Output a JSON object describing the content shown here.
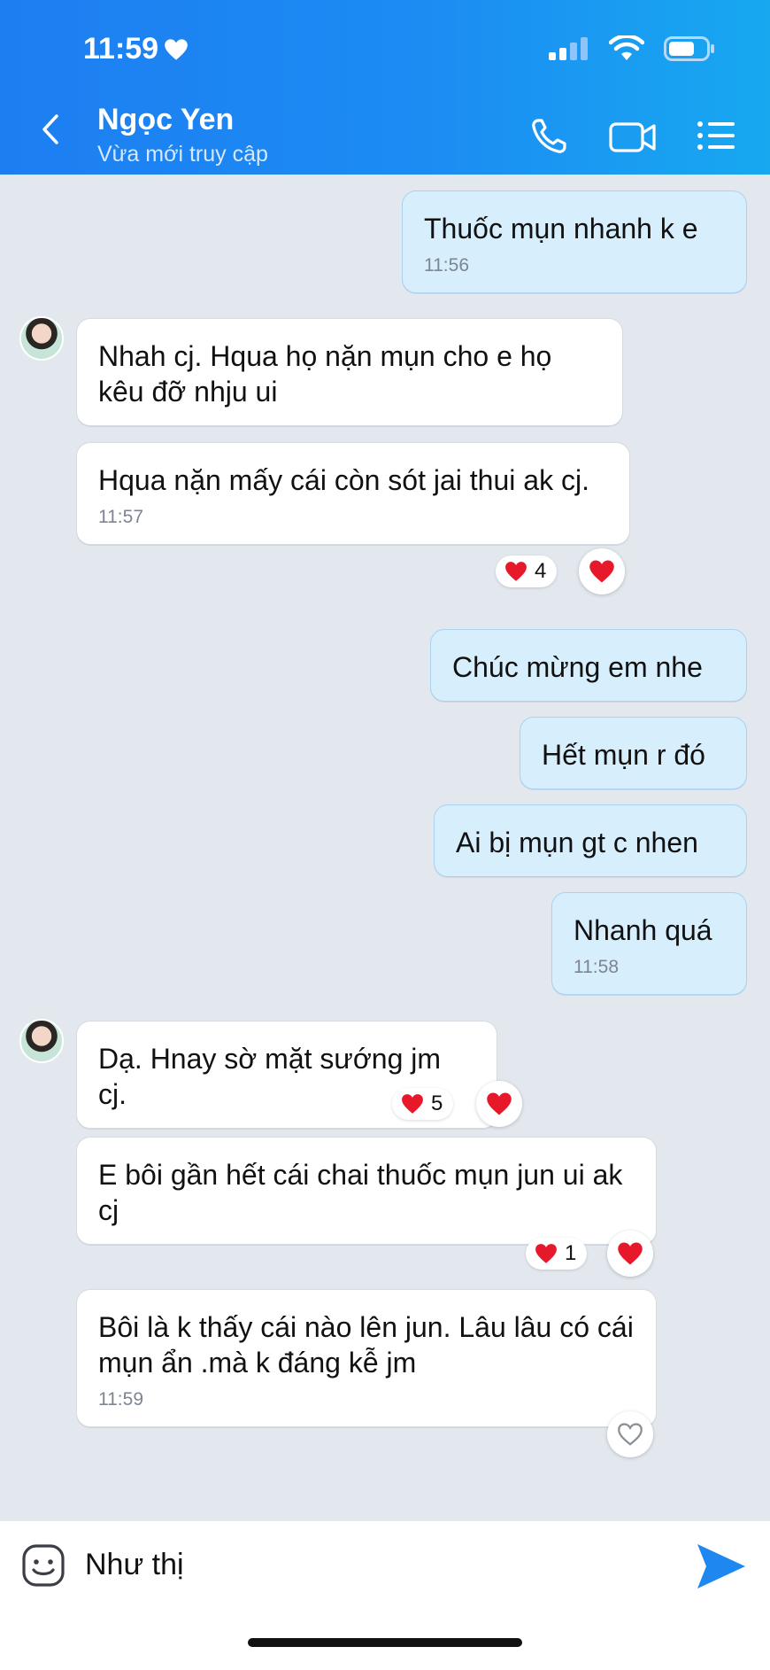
{
  "status_bar": {
    "time": "11:59"
  },
  "header": {
    "contact_name": "Ngọc Yen",
    "status": "Vừa mới truy cập"
  },
  "messages": [
    {
      "dir": "out",
      "text": "Thuốc mụn nhanh k e",
      "time": "11:56"
    },
    {
      "dir": "in",
      "text": "Nhah cj. Hqua họ nặn mụn cho e họ kêu đỡ nhju ui"
    },
    {
      "dir": "in",
      "text": "Hqua nặn mấy cái còn sót jai thui ak cj.",
      "time": "11:57",
      "reaction_count": "4"
    },
    {
      "dir": "out",
      "text": "Chúc mừng em nhe"
    },
    {
      "dir": "out",
      "text": "Hết mụn r đó"
    },
    {
      "dir": "out",
      "text": "Ai bị mụn gt c nhen"
    },
    {
      "dir": "out",
      "text": "Nhanh quá",
      "time": "11:58"
    },
    {
      "dir": "in",
      "text": "Dạ. Hnay sờ mặt sướng jm cj.",
      "reaction_count": "5"
    },
    {
      "dir": "in",
      "text": "E bôi gần hết cái chai thuốc mụn jun ui ak cj",
      "reaction_count": "1"
    },
    {
      "dir": "in",
      "text": "Bôi là k thấy cái nào lên jun. Lâu lâu có cái mụn ẩn .mà k đáng kễ jm",
      "time": "11:59"
    }
  ],
  "composer": {
    "text": "Như thị"
  },
  "colors": {
    "header": "#1c8cf3",
    "out_bubble": "#d7eefd",
    "in_bubble": "#ffffff",
    "heart": "#e8182b",
    "send": "#1e88f0"
  },
  "icons": [
    "heart-icon",
    "signal-icon",
    "wifi-icon",
    "battery-icon",
    "back-icon",
    "phone-icon",
    "video-icon",
    "menu-icon",
    "emoji-icon",
    "send-icon"
  ]
}
